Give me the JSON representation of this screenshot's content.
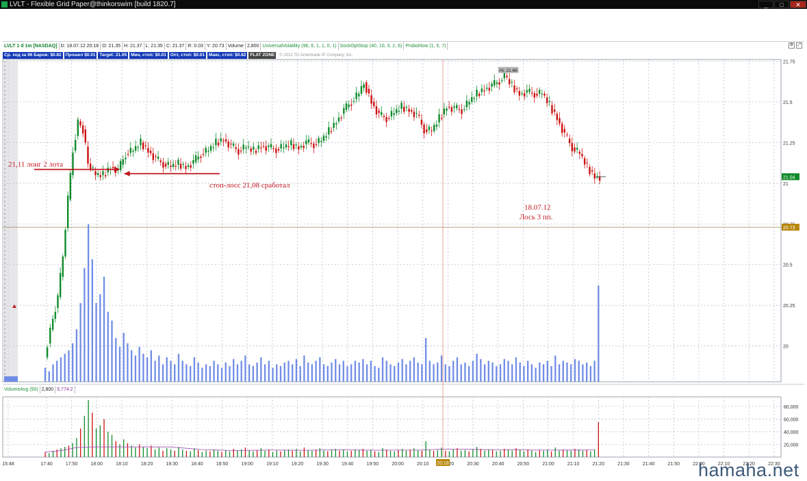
{
  "window": {
    "title": "LVLT - Flexible Grid Paper@thinkorswim [build 1820.7]",
    "controls": [
      "_",
      "□",
      "✕"
    ]
  },
  "info_bar": [
    "LVLT 1 d 1m [NASDAQ]",
    "D: 18.07.12 20:18",
    "O: 21.35",
    "H: 21.37",
    "L: 21.35",
    "C: 21.37",
    "R: 0.03",
    "Y: 20.73",
    "Volume",
    "2,800",
    "UniversalVolatility (96, 6, 1, 1, 0, 1)",
    "SockOptStop (40, 10, 3, 2, 6)",
    "Probohlow (1, 5, 7)"
  ],
  "order_bar": [
    "Ср. ход за 96 Баров: $0.82",
    "Прошел $0.01",
    "Target: 21.05",
    "Мин, стоп: $0.01",
    "Опт, стоп: $0.01",
    "Макс, стоп: $0.82"
  ],
  "flat_zone": "FLAT ZONE",
  "copyright": "© 2012 TD Ameritrade IP Company, Inc.",
  "lower_bar": [
    "VolumeAvg (50)",
    "2,800",
    "5,774.2"
  ],
  "watermark": "hamaha.net",
  "annotations": {
    "entry": "21,11 лонг 2 лота",
    "stop": "стоп-лосс 21,08 сработал",
    "date": "18.07.12",
    "loss": "Лось 3 пп."
  },
  "colors": {
    "up": "#0e8a2a",
    "down": "#cc1010",
    "volume_bar": "#6f8ce6",
    "annotation": "#c0141b",
    "price_tag": "#0e8a2a",
    "y_tag": "#b8860b",
    "cursor": "#e38a7a"
  },
  "chart_data": {
    "type": "candlestick",
    "title": "LVLT 1 d 1m [NASDAQ]",
    "x_ticks": [
      "15:48",
      "17:40",
      "17:50",
      "18:00",
      "18:10",
      "18:20",
      "18:30",
      "18:40",
      "18:50",
      "19:00",
      "19:10",
      "19:20",
      "19:30",
      "19:40",
      "19:50",
      "20:00",
      "20:10",
      "20:20",
      "20:30",
      "20:40",
      "20:50",
      "21:00",
      "21:10",
      "21:20",
      "21:30",
      "21:40",
      "21:50",
      "22:00",
      "22:10",
      "22:20",
      "22:30"
    ],
    "cursor_time": "20:18",
    "price_axis": {
      "ticks": [
        21.75,
        21.5,
        21.25,
        21,
        20.75,
        20.5,
        20.25,
        20
      ],
      "labels": [
        "21.75",
        "21.5",
        "21.25",
        "21",
        "20.75",
        "20.5",
        "20.25",
        "20"
      ],
      "range": [
        19.78,
        21.76
      ]
    },
    "last_price": "21.04",
    "y_close": "20.73",
    "high_label": "Hi: 21.66",
    "volume_axis": {
      "ticks": [
        80000,
        60000,
        40000,
        20000
      ],
      "labels": [
        "80,000",
        "60,000",
        "40,000",
        "20,000"
      ],
      "range": [
        0,
        95000
      ]
    },
    "price_path": [
      [
        "17:38",
        19.93
      ],
      [
        "17:42",
        20.1
      ],
      [
        "17:45",
        20.3
      ],
      [
        "17:47",
        20.55
      ],
      [
        "17:49",
        20.9
      ],
      [
        "17:51",
        21.2
      ],
      [
        "17:53",
        21.38
      ],
      [
        "17:55",
        21.33
      ],
      [
        "17:57",
        21.12
      ],
      [
        "18:00",
        21.05
      ],
      [
        "18:03",
        21.05
      ],
      [
        "18:06",
        21.1
      ],
      [
        "18:09",
        21.08
      ],
      [
        "18:12",
        21.18
      ],
      [
        "18:15",
        21.2
      ],
      [
        "18:18",
        21.25
      ],
      [
        "18:21",
        21.2
      ],
      [
        "18:24",
        21.15
      ],
      [
        "18:27",
        21.12
      ],
      [
        "18:30",
        21.1
      ],
      [
        "18:33",
        21.12
      ],
      [
        "18:36",
        21.1
      ],
      [
        "18:39",
        21.13
      ],
      [
        "18:42",
        21.18
      ],
      [
        "18:45",
        21.2
      ],
      [
        "18:48",
        21.25
      ],
      [
        "18:51",
        21.27
      ],
      [
        "18:54",
        21.23
      ],
      [
        "18:57",
        21.2
      ],
      [
        "19:00",
        21.22
      ],
      [
        "19:03",
        21.2
      ],
      [
        "19:06",
        21.23
      ],
      [
        "19:09",
        21.22
      ],
      [
        "19:12",
        21.21
      ],
      [
        "19:15",
        21.22
      ],
      [
        "19:18",
        21.24
      ],
      [
        "19:21",
        21.22
      ],
      [
        "19:24",
        21.25
      ],
      [
        "19:27",
        21.24
      ],
      [
        "19:30",
        21.26
      ],
      [
        "19:33",
        21.32
      ],
      [
        "19:36",
        21.38
      ],
      [
        "19:39",
        21.45
      ],
      [
        "19:42",
        21.5
      ],
      [
        "19:45",
        21.55
      ],
      [
        "19:47",
        21.62
      ],
      [
        "19:50",
        21.5
      ],
      [
        "19:53",
        21.42
      ],
      [
        "19:56",
        21.4
      ],
      [
        "19:59",
        21.43
      ],
      [
        "20:02",
        21.47
      ],
      [
        "20:05",
        21.45
      ],
      [
        "20:08",
        21.42
      ],
      [
        "20:11",
        21.33
      ],
      [
        "20:14",
        21.32
      ],
      [
        "20:17",
        21.4
      ],
      [
        "20:20",
        21.47
      ],
      [
        "20:23",
        21.46
      ],
      [
        "20:26",
        21.45
      ],
      [
        "20:29",
        21.5
      ],
      [
        "20:32",
        21.55
      ],
      [
        "20:35",
        21.58
      ],
      [
        "20:38",
        21.6
      ],
      [
        "20:41",
        21.63
      ],
      [
        "20:43",
        21.66
      ],
      [
        "20:46",
        21.6
      ],
      [
        "20:49",
        21.55
      ],
      [
        "20:52",
        21.56
      ],
      [
        "20:55",
        21.55
      ],
      [
        "20:58",
        21.55
      ],
      [
        "21:01",
        21.48
      ],
      [
        "21:04",
        21.4
      ],
      [
        "21:07",
        21.3
      ],
      [
        "21:10",
        21.22
      ],
      [
        "21:13",
        21.18
      ],
      [
        "21:16",
        21.1
      ],
      [
        "21:19",
        21.04
      ],
      [
        "21:21",
        21.04
      ]
    ],
    "volume_profile": [
      8,
      6,
      10,
      12,
      14,
      16,
      18,
      22,
      30,
      45,
      65,
      90,
      70,
      45,
      50,
      60,
      40,
      35,
      25,
      20,
      28,
      22,
      18,
      15,
      20,
      16,
      14,
      18,
      12,
      15,
      10,
      14,
      12,
      10,
      16,
      12,
      10,
      9,
      14,
      11,
      8,
      10,
      9,
      12,
      10,
      8,
      11,
      9,
      13,
      10,
      12,
      15,
      10,
      9,
      11,
      14,
      10,
      12,
      8,
      10,
      9,
      11,
      12,
      10,
      13,
      9,
      15,
      11,
      10,
      12,
      14,
      10,
      9,
      11,
      13,
      10,
      12,
      9,
      10,
      12,
      11,
      13,
      10,
      12,
      9,
      8,
      14,
      12,
      10,
      9,
      11,
      13,
      10,
      12,
      14,
      11,
      10,
      25,
      12,
      10,
      11,
      15,
      10,
      9,
      12,
      14,
      10,
      11,
      9,
      12,
      16,
      13,
      10,
      12,
      11,
      9,
      10,
      13,
      12,
      10,
      14,
      11,
      9,
      12,
      10,
      8,
      11,
      10,
      12,
      9,
      15,
      10,
      12,
      11,
      10,
      13,
      12,
      10,
      11,
      9,
      12,
      55
    ]
  }
}
